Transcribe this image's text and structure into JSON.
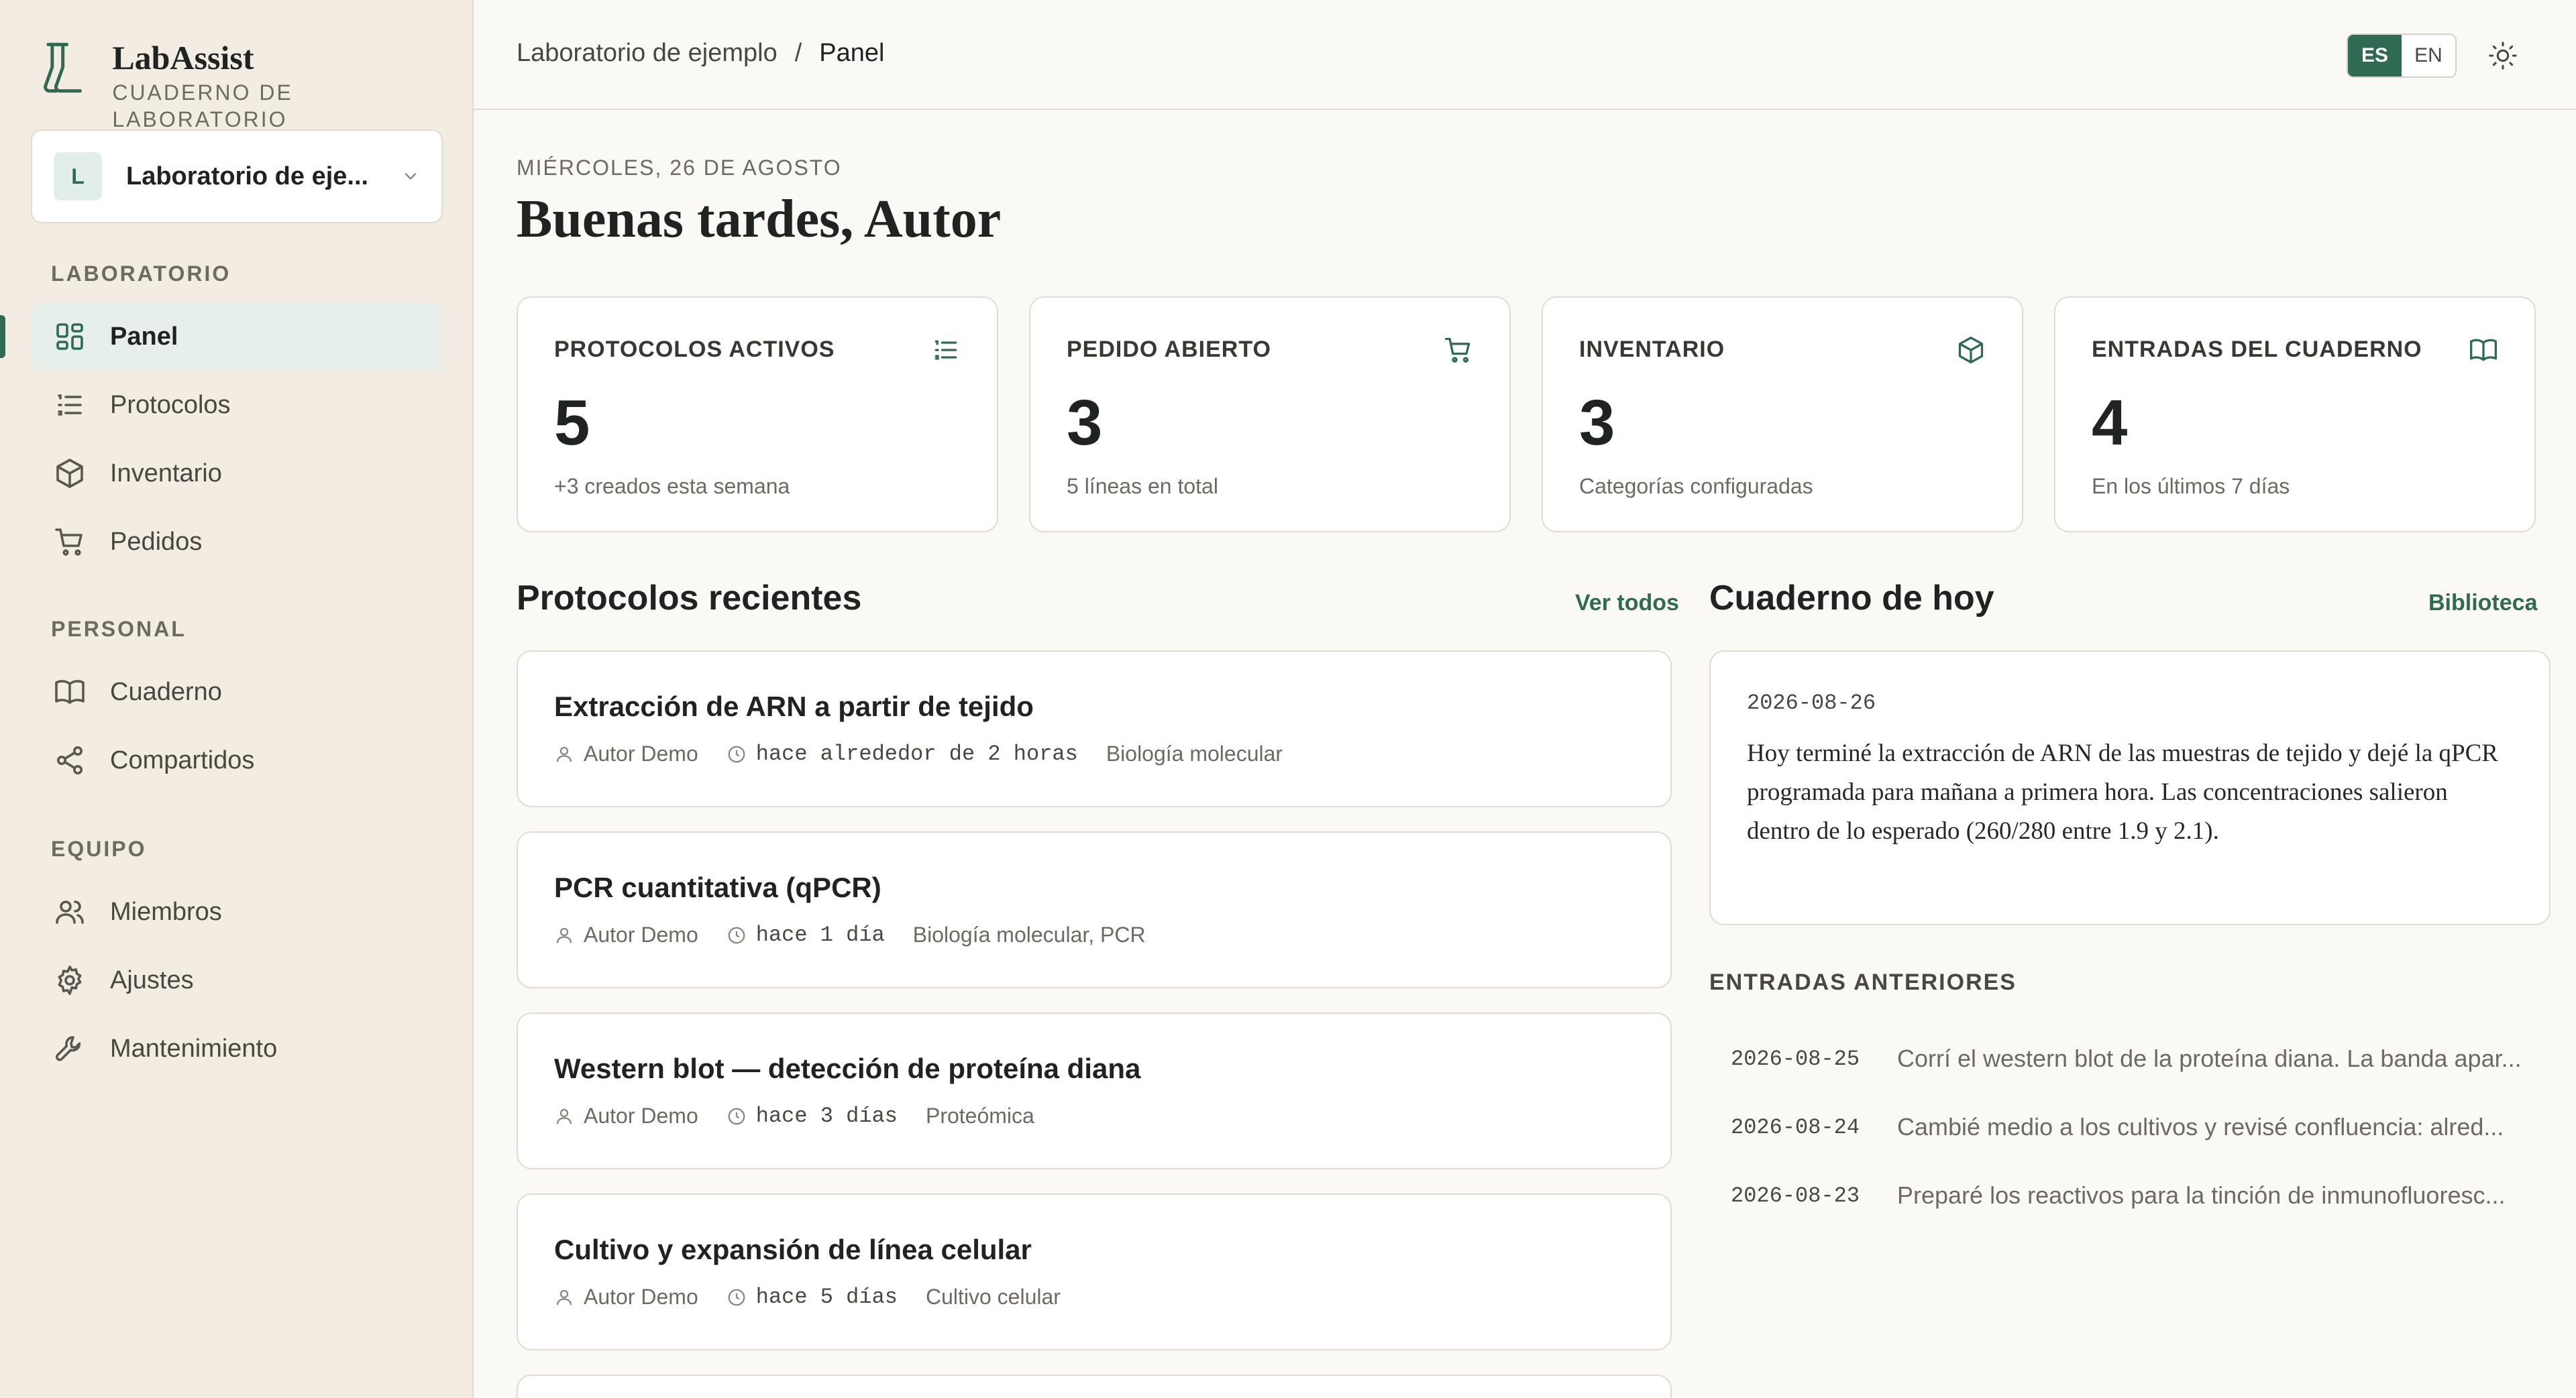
{
  "brand": {
    "name": "LabAssist",
    "subtitle": "CUADERNO DE LABORATORIO"
  },
  "lab_selector": {
    "initial": "L",
    "name": "Laboratorio de eje..."
  },
  "sidebar": {
    "sections": [
      {
        "label": "LABORATORIO"
      },
      {
        "label": "PERSONAL"
      },
      {
        "label": "EQUIPO"
      }
    ],
    "items": [
      {
        "label": "Panel",
        "icon": "dashboard-icon",
        "active": true
      },
      {
        "label": "Protocolos",
        "icon": "list-icon"
      },
      {
        "label": "Inventario",
        "icon": "box-icon"
      },
      {
        "label": "Pedidos",
        "icon": "cart-icon"
      },
      {
        "label": "Cuaderno",
        "icon": "book-icon"
      },
      {
        "label": "Compartidos",
        "icon": "share-icon"
      },
      {
        "label": "Miembros",
        "icon": "users-icon"
      },
      {
        "label": "Ajustes",
        "icon": "gear-icon"
      },
      {
        "label": "Mantenimiento",
        "icon": "wrench-icon"
      }
    ]
  },
  "topbar": {
    "breadcrumb": {
      "parent": "Laboratorio de ejemplo",
      "separator": "/",
      "current": "Panel"
    },
    "lang": {
      "es": "ES",
      "en": "EN",
      "selected": "ES"
    }
  },
  "header": {
    "date": "MIÉRCOLES, 26 DE AGOSTO",
    "greeting": "Buenas tardes, Autor"
  },
  "stats": [
    {
      "title": "PROTOCOLOS ACTIVOS",
      "value": "5",
      "note": "+3 creados esta semana",
      "icon": "list-icon"
    },
    {
      "title": "PEDIDO ABIERTO",
      "value": "3",
      "note": "5 líneas en total",
      "icon": "cart-icon"
    },
    {
      "title": "INVENTARIO",
      "value": "3",
      "note": "Categorías configuradas",
      "icon": "box-icon"
    },
    {
      "title": "ENTRADAS DEL CUADERNO",
      "value": "4",
      "note": "En los últimos 7 días",
      "icon": "book-icon"
    }
  ],
  "protocols": {
    "title": "Protocolos recientes",
    "link": "Ver todos",
    "items": [
      {
        "title": "Extracción de ARN a partir de tejido",
        "author": "Autor Demo",
        "time": "hace alrededor de 2 horas",
        "tags": "Biología molecular"
      },
      {
        "title": "PCR cuantitativa (qPCR)",
        "author": "Autor Demo",
        "time": "hace 1 día",
        "tags": "Biología molecular, PCR"
      },
      {
        "title": "Western blot — detección de proteína diana",
        "author": "Autor Demo",
        "time": "hace 3 días",
        "tags": "Proteómica"
      },
      {
        "title": "Cultivo y expansión de línea celular",
        "author": "Autor Demo",
        "time": "hace 5 días",
        "tags": "Cultivo celular"
      }
    ]
  },
  "notebook": {
    "title": "Cuaderno de hoy",
    "link": "Biblioteca",
    "today": {
      "date": "2026-08-26",
      "body": "Hoy terminé la extracción de ARN de las muestras de tejido y dejé la qPCR programada para mañana a primera hora. Las concentraciones salieron dentro de lo esperado (260/280 entre 1.9 y 2.1)."
    },
    "previous_label": "ENTRADAS ANTERIORES",
    "previous": [
      {
        "date": "2026-08-25",
        "text": "Corrí el western blot de la proteína diana. La banda apar..."
      },
      {
        "date": "2026-08-24",
        "text": "Cambié medio a los cultivos y revisé confluencia: alred..."
      },
      {
        "date": "2026-08-23",
        "text": "Preparé los reactivos para la tinción de inmunofluoresc..."
      }
    ]
  },
  "colors": {
    "accent": "#2f6a52",
    "sidebar_bg": "#f2ece3",
    "page_bg": "#fbf9f5"
  }
}
